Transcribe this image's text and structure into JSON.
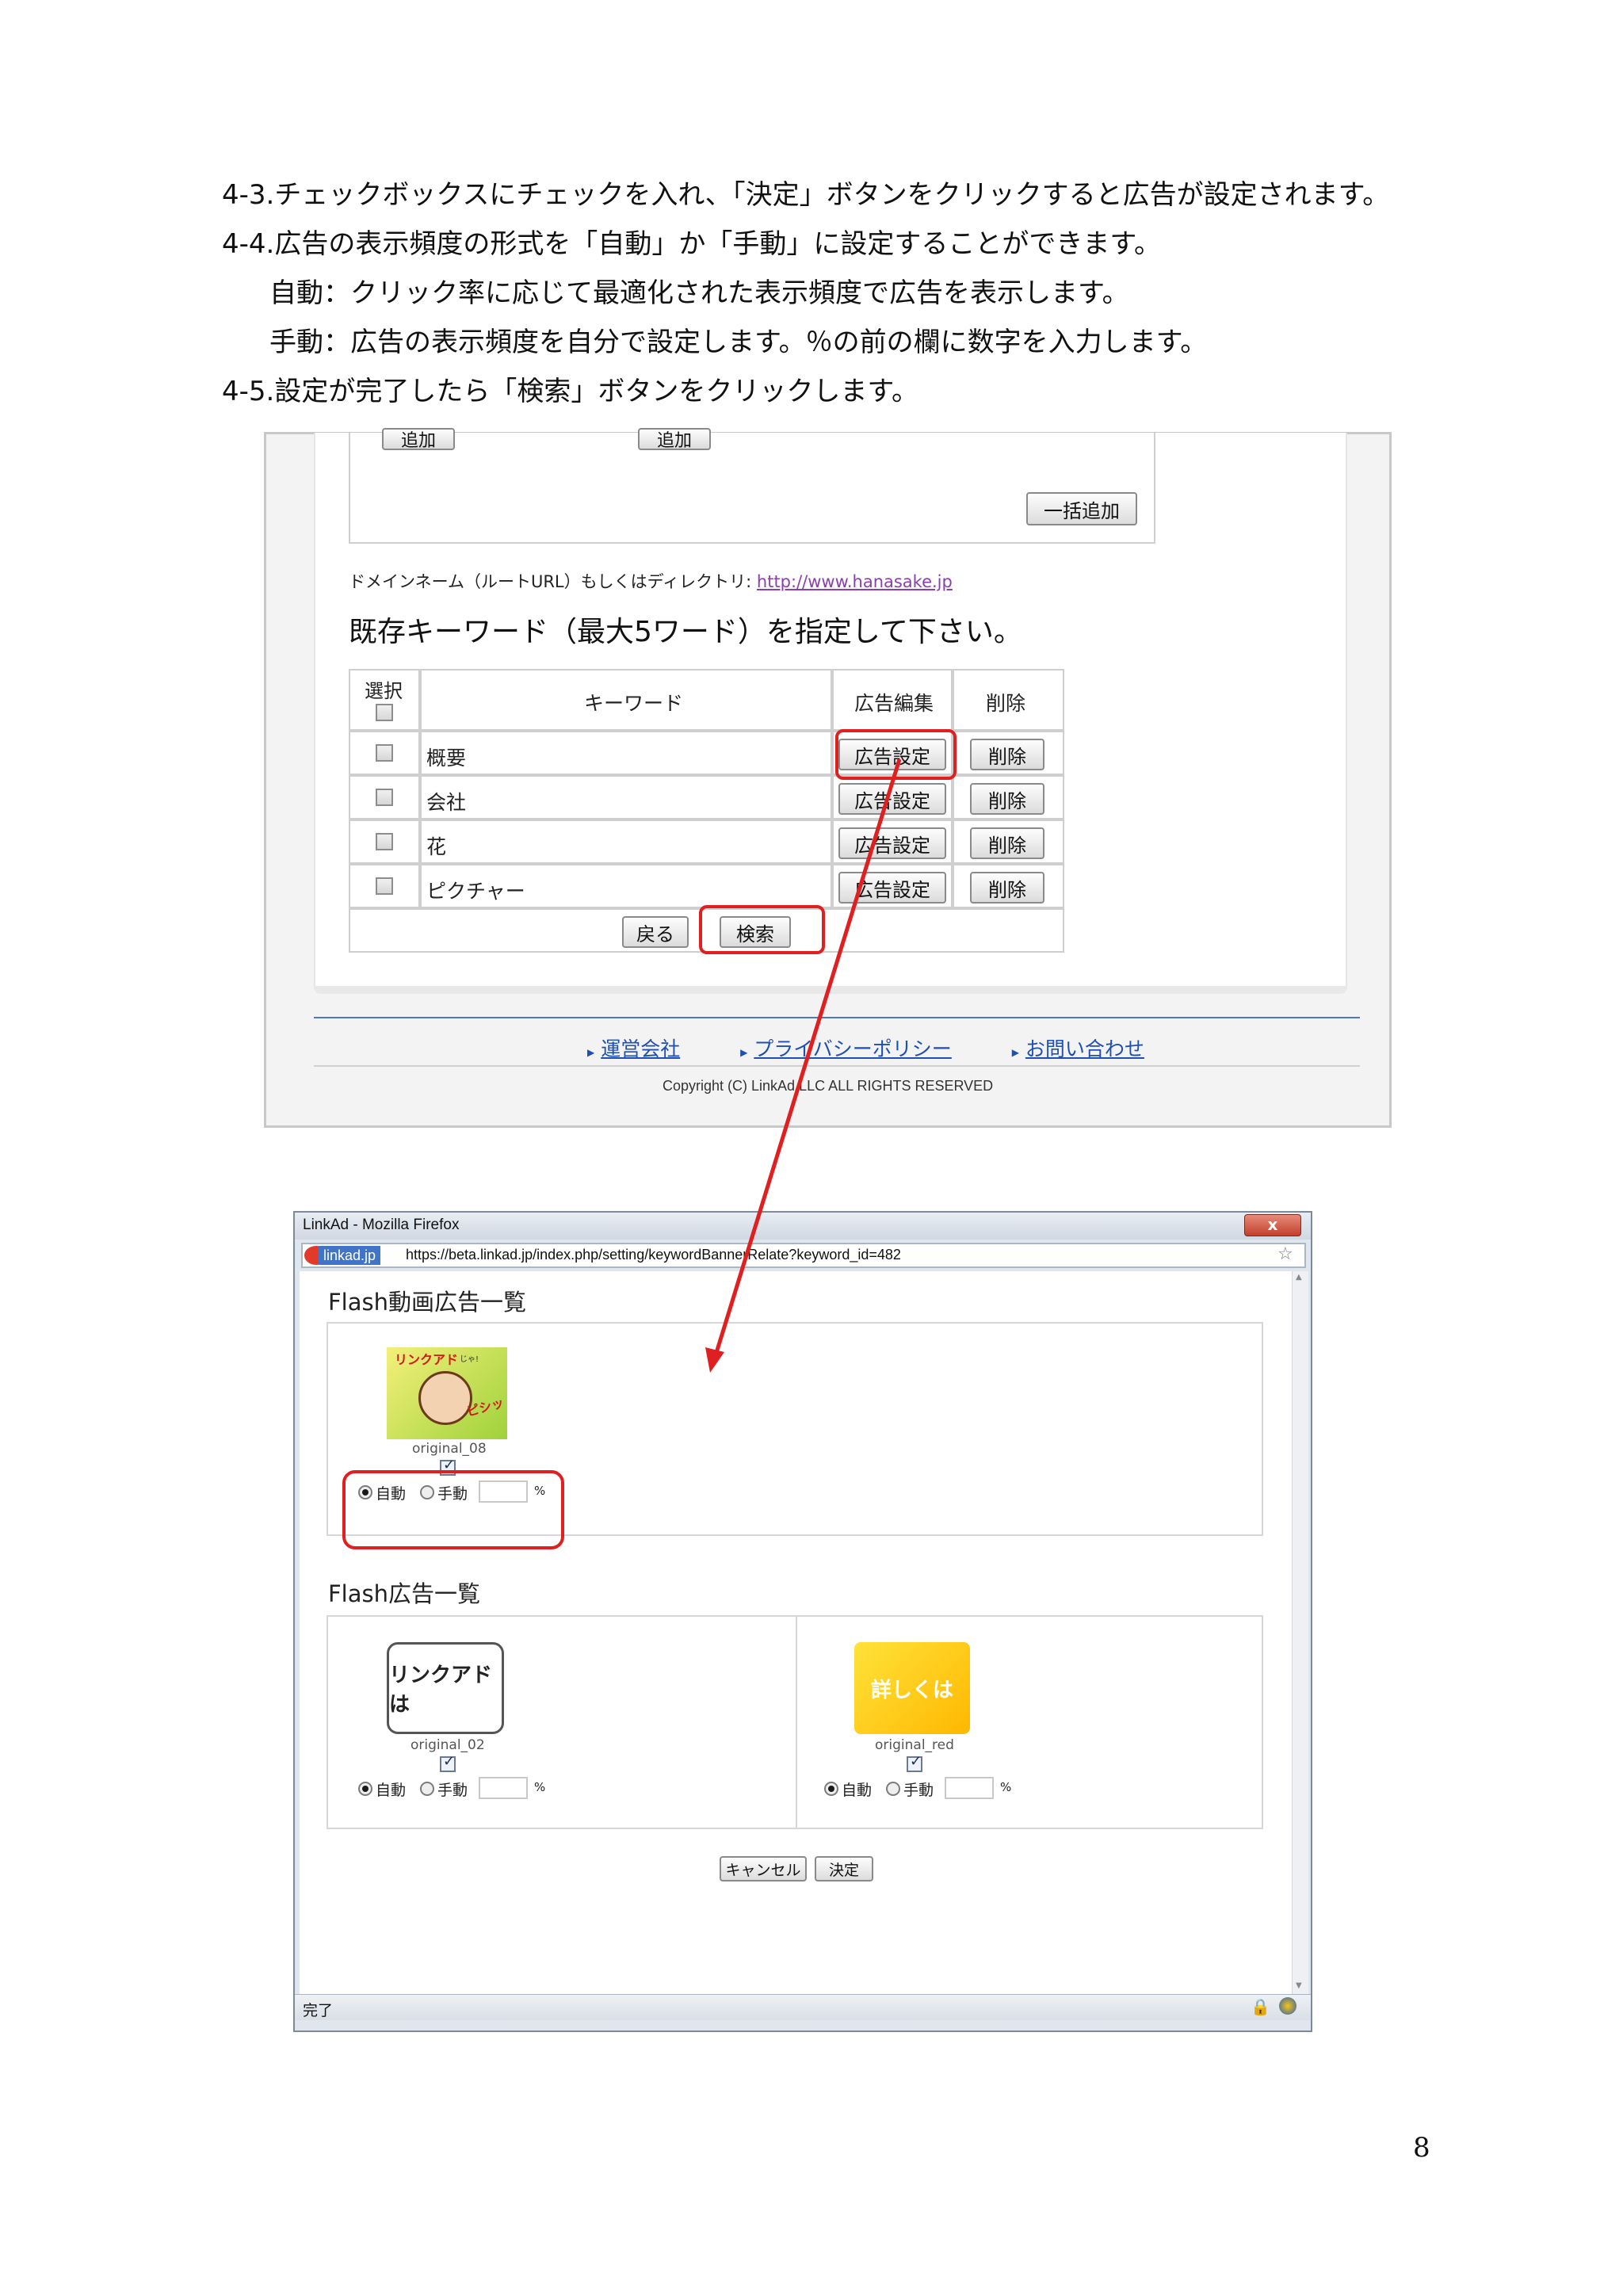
{
  "instructions": [
    {
      "num": "4-3.",
      "text": "チェックボックスにチェックを入れ、「決定」ボタンをクリックすると広告が設定されます。"
    },
    {
      "num": "4-4.",
      "text": "広告の表示頻度の形式を「自動」か「手動」に設定することができます。"
    },
    {
      "num": "",
      "text": "自動：クリック率に応じて最適化された表示頻度で広告を表示します。"
    },
    {
      "num": "",
      "text": "手動：広告の表示頻度を自分で設定します。％の前の欄に数字を入力します。"
    },
    {
      "num": "4-5.",
      "text": "設定が完了したら「検索」ボタンをクリックします。"
    }
  ],
  "top_screenshot": {
    "add_button_label": "追加",
    "bulk_add_button": "一括追加",
    "domain_label": "ドメインネーム（ルートURL）もしくはディレクトリ:",
    "domain_url": "http://www.hanasake.jp",
    "section_heading": "既存キーワード（最大5ワード）を指定して下さい。",
    "table_headers": {
      "select": "選択",
      "keyword": "キーワード",
      "ad_edit": "広告編集",
      "delete": "削除"
    },
    "rows": [
      {
        "keyword": "概要",
        "ad_button": "広告設定",
        "delete_button": "削除"
      },
      {
        "keyword": "会社",
        "ad_button": "広告設定",
        "delete_button": "削除"
      },
      {
        "keyword": "花",
        "ad_button": "広告設定",
        "delete_button": "削除"
      },
      {
        "keyword": "ピクチャー",
        "ad_button": "広告設定",
        "delete_button": "削除"
      }
    ],
    "back_button": "戻る",
    "search_button": "検索",
    "footer_links": [
      "運営会社",
      "プライバシーポリシー",
      "お問い合わせ"
    ],
    "copyright": "Copyright (C) LinkAd LLC ALL RIGHTS RESERVED"
  },
  "browser_window": {
    "title": "LinkAd - Mozilla Firefox",
    "close_glyph": "x",
    "site_badge": "linkad.jp",
    "url": "https://beta.linkad.jp/index.php/setting/keywordBannerRelate?keyword_id=482",
    "flash_video_heading": "Flash動画広告一覧",
    "flash_heading": "Flash広告一覧",
    "ads_video": [
      {
        "name": "original_08",
        "banner_title": "リンクアド",
        "banner_small": "じゃ!",
        "banner_sfx": "ピシッ",
        "checked": true,
        "mode": "自動"
      }
    ],
    "ads_flash": [
      {
        "name": "original_02",
        "banner_text": "リンクアドは",
        "checked": true,
        "mode": "自動"
      },
      {
        "name": "original_red",
        "banner_text": "詳しくは",
        "checked": true,
        "mode": "自動"
      }
    ],
    "auto_label": "自動",
    "manual_label": "手動",
    "percent_sign": "%",
    "cancel_button": "キャンセル",
    "confirm_button": "決定",
    "status_text": "完了"
  },
  "page_number": "8",
  "colors": {
    "highlight_red": "#e02020",
    "link_blue": "#1e4fb5",
    "window_frame": "#7d8a99"
  }
}
